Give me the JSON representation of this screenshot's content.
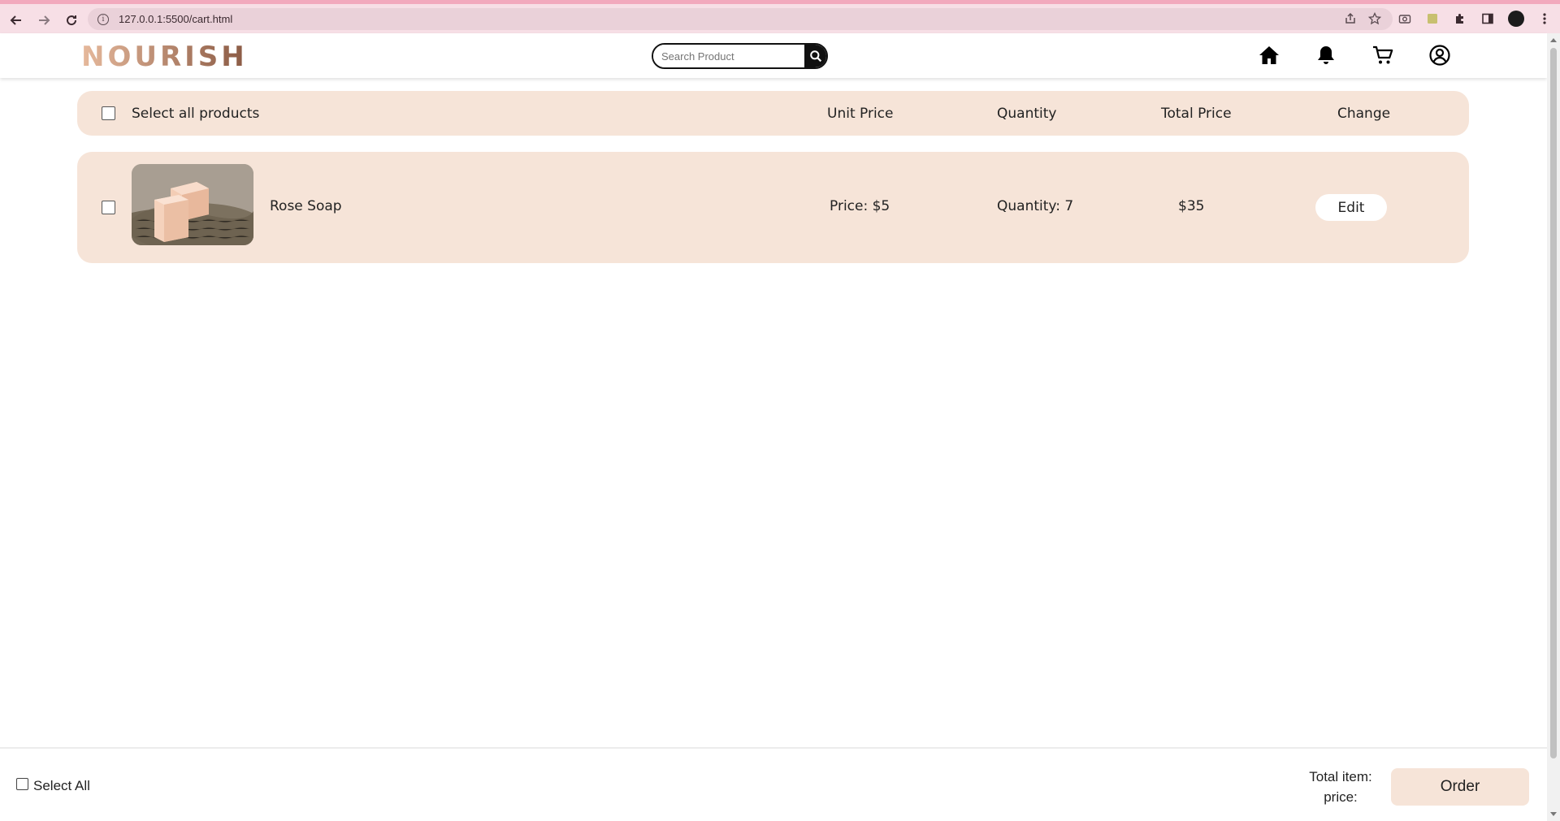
{
  "browser": {
    "url": "127.0.0.1:5500/cart.html",
    "icons": [
      "back-arrow-icon",
      "forward-arrow-icon",
      "reload-icon",
      "info-icon",
      "share-icon",
      "star-icon",
      "camera-icon",
      "extension-icon",
      "puzzle-icon",
      "sidebar-icon",
      "profile-avatar",
      "menu-dots-icon"
    ]
  },
  "header": {
    "logo": "NOURISH",
    "search_placeholder": "Search Product",
    "nav_icons": [
      "home-icon",
      "bell-icon",
      "cart-icon",
      "account-icon"
    ]
  },
  "cart_header": {
    "select_all": "Select all products",
    "unit_price": "Unit Price",
    "quantity": "Quantity",
    "total_price": "Total Price",
    "change": "Change"
  },
  "items": [
    {
      "name": "Rose Soap",
      "price": "Price: $5",
      "quantity": "Quantity: 7",
      "total": "$35",
      "edit_label": "Edit"
    }
  ],
  "footer": {
    "select_all": "Select All",
    "total_label": "Total item: price:",
    "order_label": "Order"
  },
  "colors": {
    "accent_beige": "#f6e4d8",
    "chrome_pink": "#f7dfe6",
    "logo_gradient_start": "#e6b99c",
    "logo_gradient_end": "#8a5a44"
  }
}
